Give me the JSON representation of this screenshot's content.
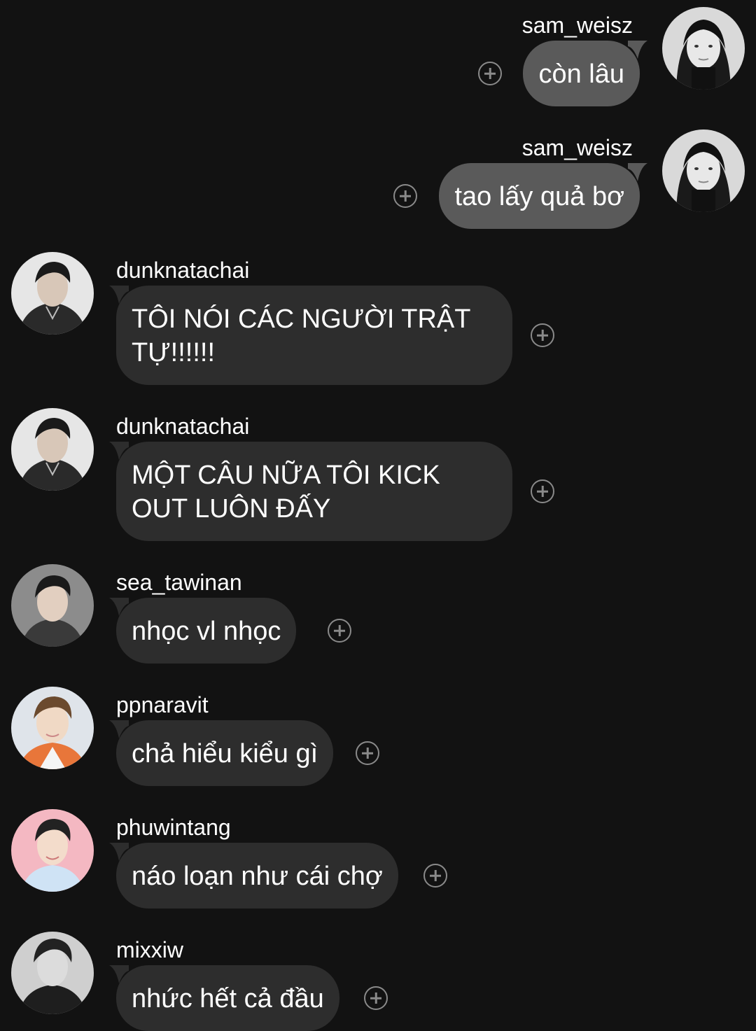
{
  "theme": {
    "background": "#121212",
    "bubble_out": "#5a5a5a",
    "bubble_in": "#2d2d2d",
    "text": "#ffffff",
    "icon": "#8a8a8a"
  },
  "messages": [
    {
      "direction": "out",
      "username": "sam_weisz",
      "text": "còn lâu",
      "avatar": "avatar-sam-weisz"
    },
    {
      "direction": "out",
      "username": "sam_weisz",
      "text": "tao lấy quả bơ",
      "avatar": "avatar-sam-weisz"
    },
    {
      "direction": "in",
      "username": "dunknatachai",
      "text": "TÔI NÓI CÁC NGƯỜI TRẬT TỰ!!!!!!",
      "avatar": "avatar-dunknatachai"
    },
    {
      "direction": "in",
      "username": "dunknatachai",
      "text": "MỘT CÂU NỮA TÔI KICK OUT LUÔN ĐẤY",
      "avatar": "avatar-dunknatachai"
    },
    {
      "direction": "in",
      "username": "sea_tawinan",
      "text": "nhọc vl nhọc",
      "avatar": "avatar-sea-tawinan"
    },
    {
      "direction": "in",
      "username": "ppnaravit",
      "text": "chả hiểu kiểu gì",
      "avatar": "avatar-ppnaravit"
    },
    {
      "direction": "in",
      "username": "phuwintang",
      "text": "náo loạn như cái chợ",
      "avatar": "avatar-phuwintang"
    },
    {
      "direction": "in",
      "username": "mixxiw",
      "text": "nhức hết cả đầu",
      "avatar": "avatar-mixxiw"
    }
  ],
  "icons": {
    "react": "add-reaction-icon"
  }
}
